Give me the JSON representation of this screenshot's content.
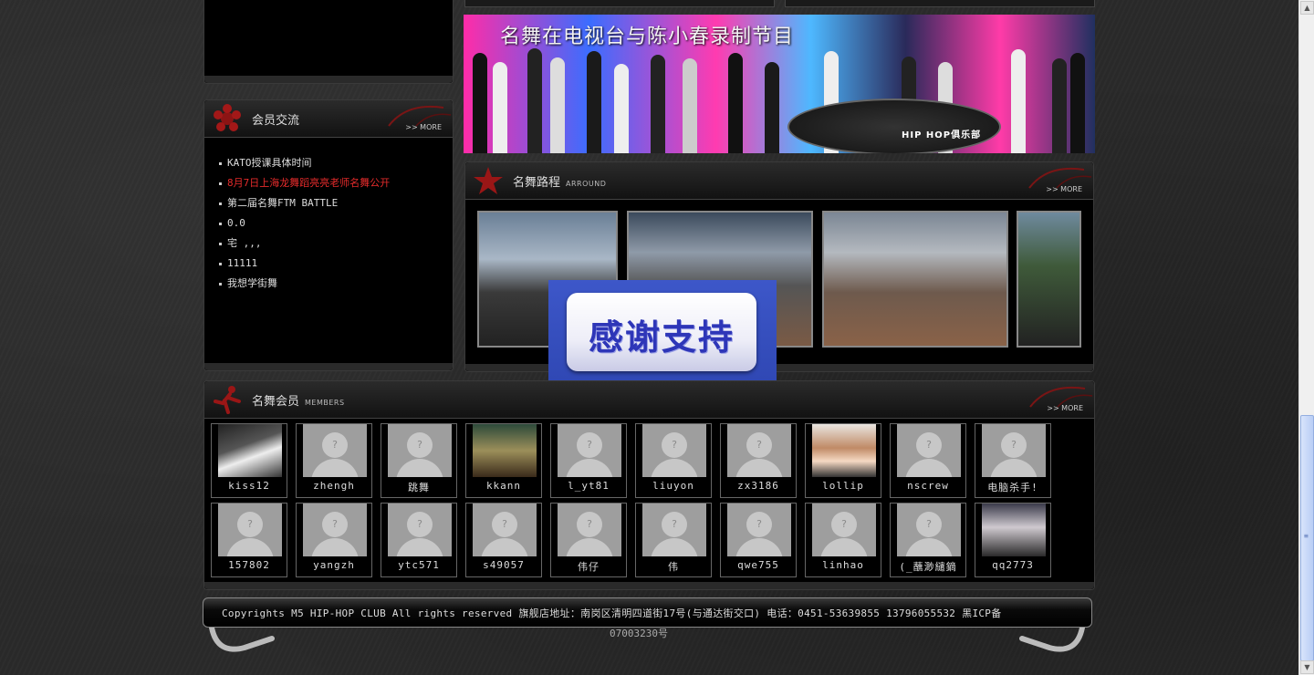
{
  "member_exchange": {
    "title": "会员交流",
    "more": ">> MORE",
    "topics": [
      {
        "text": "KATO授课具体时间",
        "hot": false
      },
      {
        "text": "8月7日上海龙舞蹈亮亮老师名舞公开",
        "hot": true
      },
      {
        "text": "第二届名舞FTM BATTLE",
        "hot": false
      },
      {
        "text": "0.0",
        "hot": false
      },
      {
        "text": "宅 ,,,",
        "hot": false
      },
      {
        "text": "11111",
        "hot": false
      },
      {
        "text": "我想学街舞",
        "hot": false
      }
    ]
  },
  "banner": {
    "title": "名舞在电视台与陈小春录制节目",
    "logo_text": "HIP HOP俱乐部"
  },
  "journey": {
    "title": "名舞路程",
    "subtitle": "ARROUND",
    "more": ">> MORE"
  },
  "overlay": {
    "text": "感谢支持"
  },
  "members": {
    "title": "名舞会员",
    "subtitle": "MEMBERS",
    "more": ">> MORE",
    "row1": [
      "kiss12",
      "zhengh",
      "跳舞",
      "kkann",
      "l_yt81",
      "liuyon",
      "zx3186",
      "lollip",
      "nscrew",
      "电脑杀手!"
    ],
    "row2": [
      "157802",
      "yangzh",
      "ytc571",
      "s49057",
      "伟仔",
      "伟",
      "qwe755",
      "linhao",
      "(_蘸渺繾鏑",
      "qq2773"
    ]
  },
  "footer": {
    "line1": "Copyrights M5 HIP-HOP CLUB All rights reserved  旗舰店地址：南岗区清明四道街17号(与通达街交口) 电话：0451-53639855  13796055532   黑ICP备",
    "line2": "07003230号"
  },
  "colors": {
    "hot_topic": "#e52b2b",
    "overlay_blue": "#2e36b8",
    "scroll_thumb": "#b9cdf5"
  }
}
